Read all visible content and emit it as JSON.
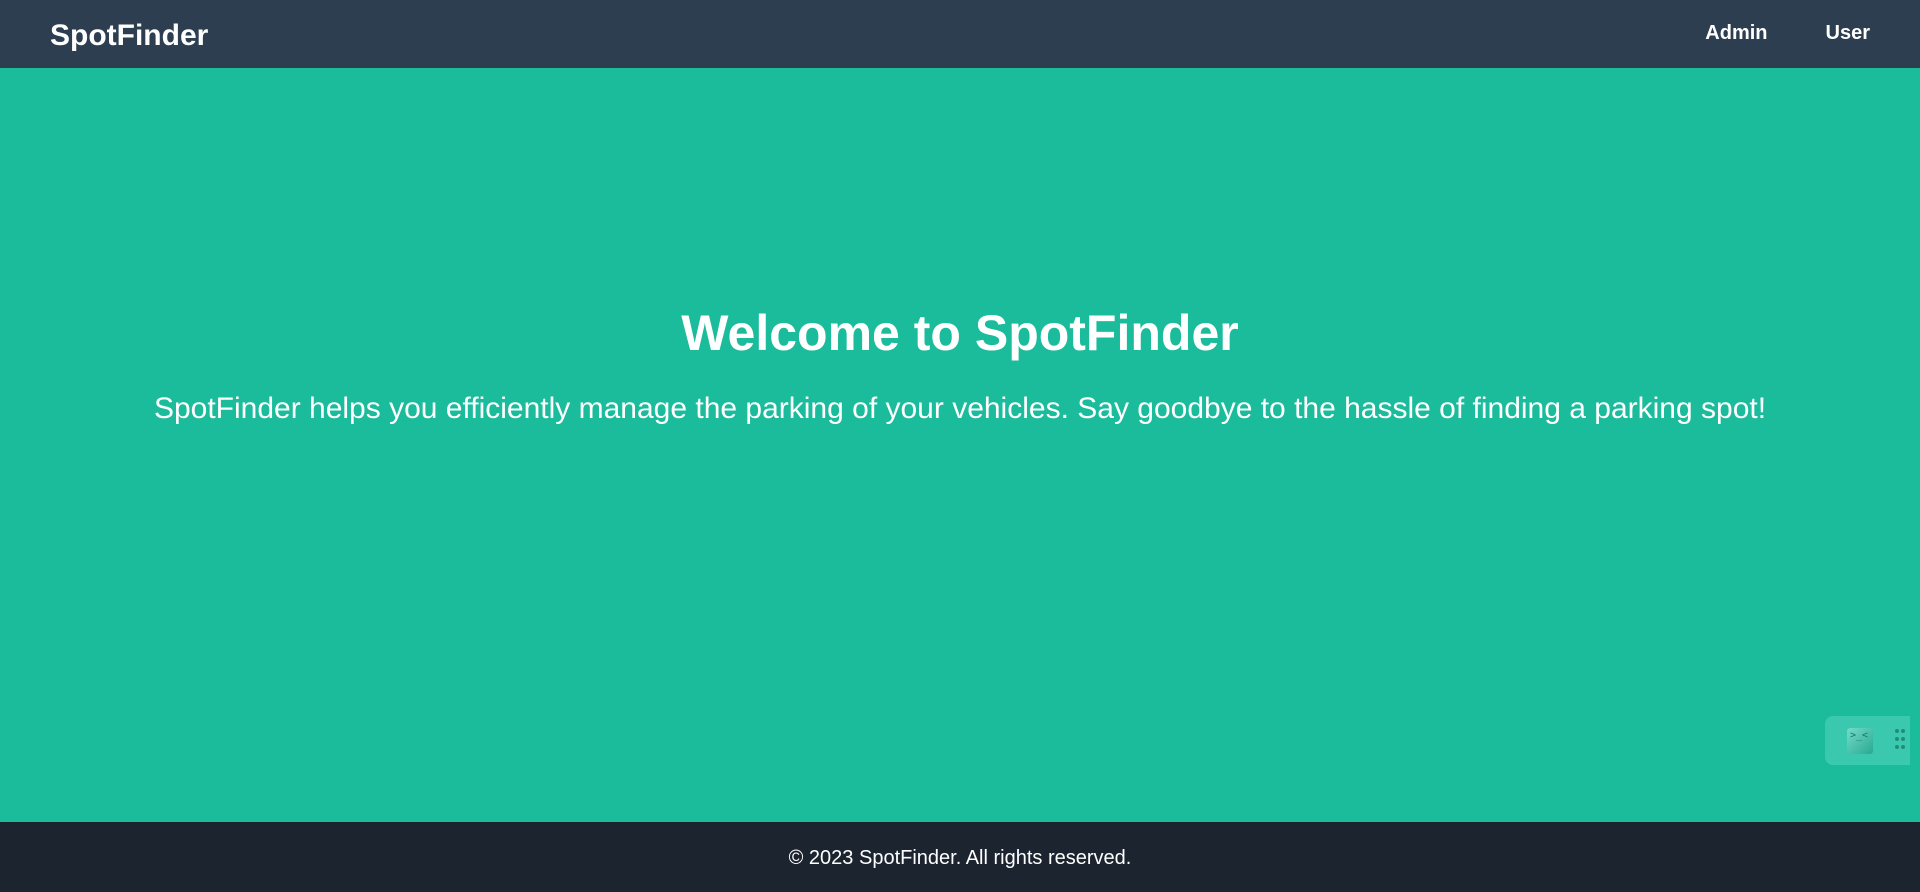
{
  "header": {
    "brand": "SpotFinder",
    "nav": [
      {
        "label": "Admin"
      },
      {
        "label": "User"
      }
    ]
  },
  "hero": {
    "title": "Welcome to SpotFinder",
    "text": "SpotFinder helps you efficiently manage the parking of your vehicles. Say goodbye to the hassle of finding a parking spot!"
  },
  "widget": {
    "face_glyph": ">_<",
    "icon": "floating-assistant-icon",
    "grip_icon": "drag-handle-icon"
  },
  "footer": {
    "text": "© 2023 SpotFinder. All rights reserved."
  },
  "colors": {
    "navbar": "#2c3e50",
    "hero": "#1abc9c",
    "footer": "#1c2430",
    "text": "#ffffff"
  }
}
